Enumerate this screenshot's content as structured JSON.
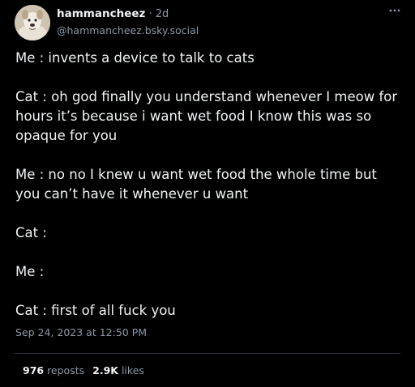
{
  "post": {
    "author": {
      "display_name": "hammancheez",
      "time_sep": " · ",
      "time_ago": "2d",
      "handle": "@hammancheez.bsky.social",
      "avatar_icon": "dog-avatar"
    },
    "menu_icon": "more-horizontal-icon",
    "paragraphs": [
      "Me : invents a device to talk to cats",
      "Cat : oh god finally you understand whenever I meow for hours it’s because i want wet food I know this was so opaque for you",
      "Me : no no I knew u want wet food the whole time but you can’t have it whenever u want",
      "Cat :",
      "Me :",
      "Cat : first of all fuck you"
    ],
    "timestamp": "Sep 24, 2023 at 12:50 PM",
    "stats": {
      "reposts_count": "976",
      "reposts_label": " reposts",
      "likes_count": "2.9K",
      "likes_label": " likes"
    }
  },
  "colors": {
    "background": "#000000",
    "text": "#f1f3f5",
    "muted": "#8b98a5",
    "divider": "#2b3340"
  }
}
